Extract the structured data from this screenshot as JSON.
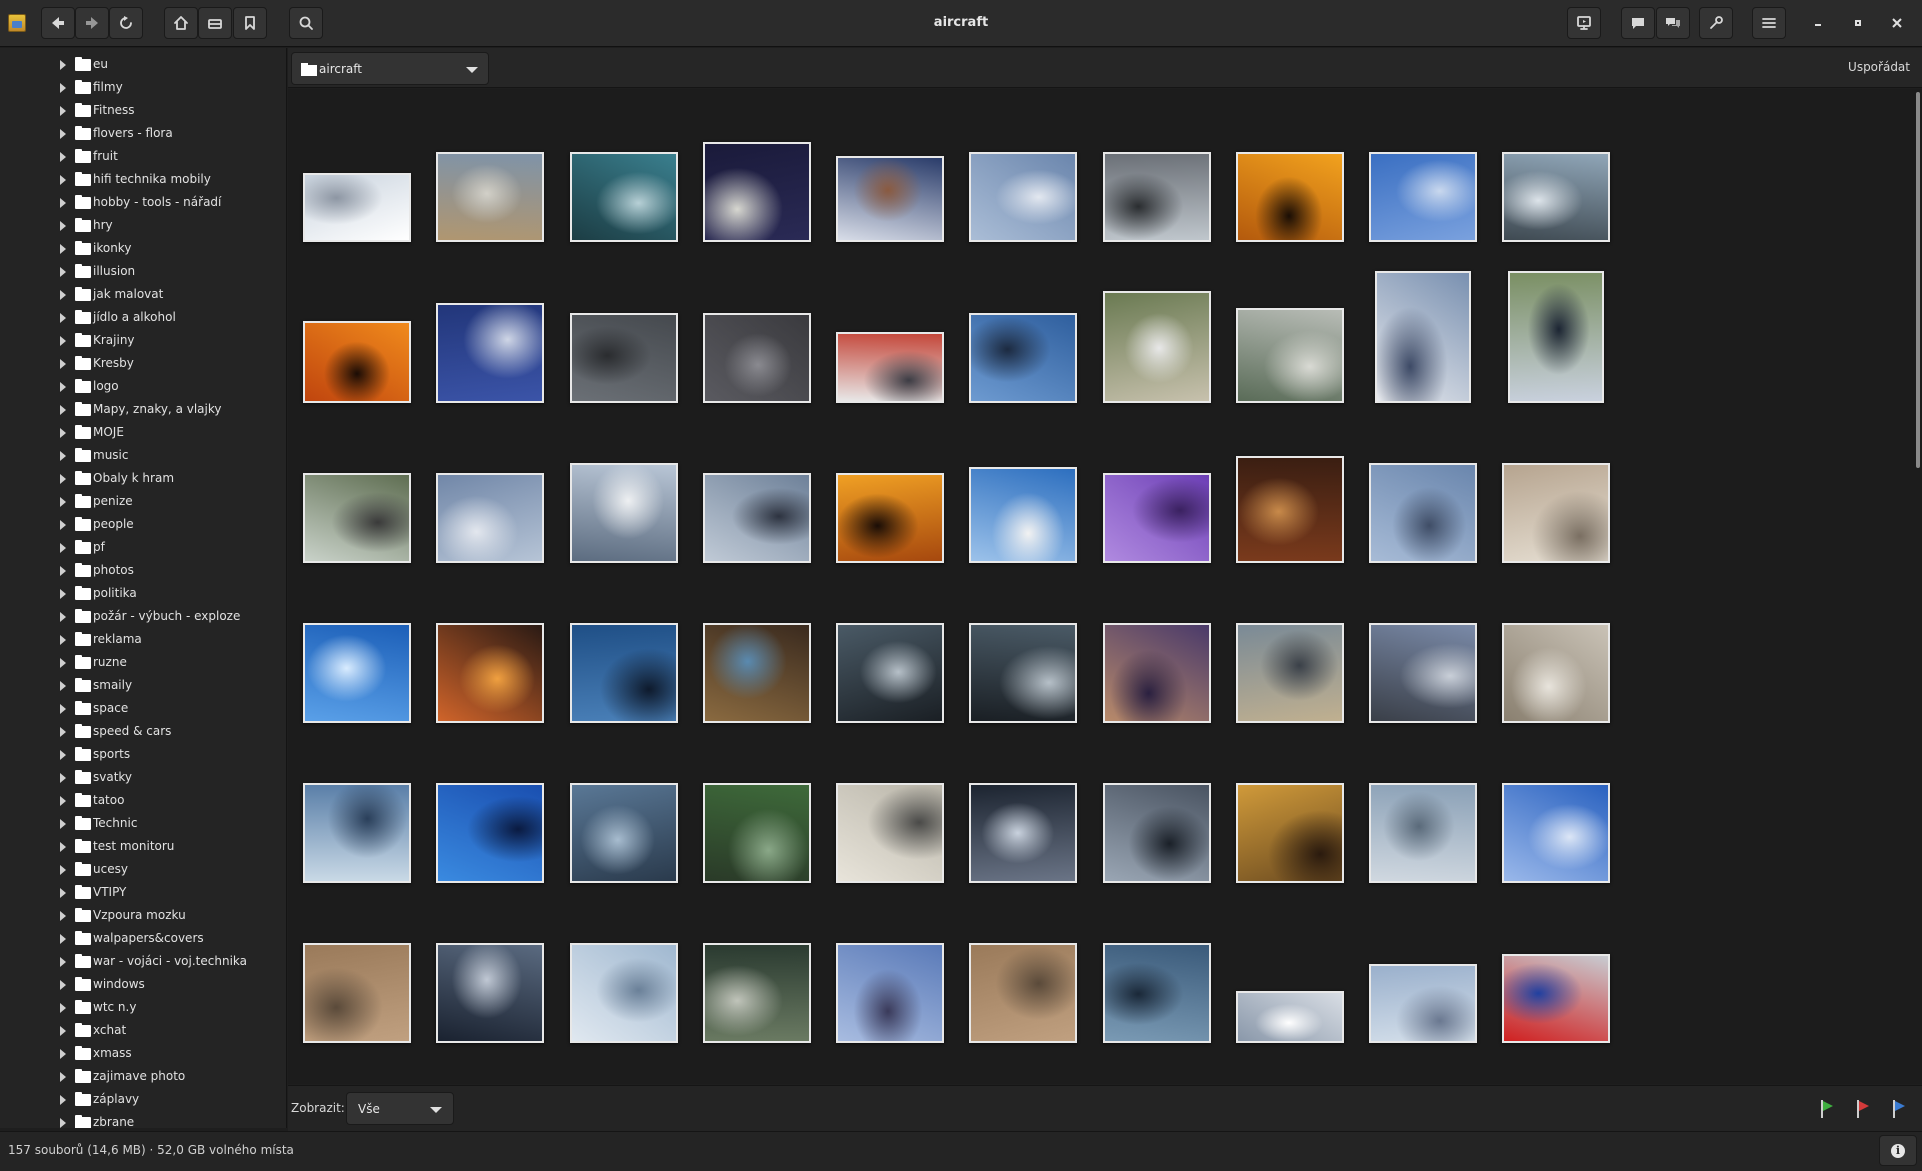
{
  "window": {
    "title": "aircraft"
  },
  "toolbar": {
    "path": "aircraft",
    "sort_label": "Uspořádat"
  },
  "sidebar": {
    "folders": [
      "eu",
      "filmy",
      "Fitness",
      "flovers - flora",
      "fruit",
      "hifi technika mobily",
      "hobby - tools - nářadí",
      "hry",
      "ikonky",
      "illusion",
      "jak malovat",
      "jídlo a alkohol",
      "Krajiny",
      "Kresby",
      "logo",
      "Mapy, znaky, a vlajky",
      "MOJE",
      "music",
      "Obaly k hram",
      "penize",
      "people",
      "pf",
      "photos",
      "politika",
      "požár - výbuch - exploze",
      "reklama",
      "ruzne",
      "smaily",
      "space",
      "speed & cars",
      "sports",
      "svatky",
      "tatoo",
      "Technic",
      "test monitoru",
      "ucesy",
      "VTIPY",
      "Vzpoura mozku",
      "walpapers&covers",
      "war - vojáci - voj.technika",
      "windows",
      "wtc n.y",
      "xchat",
      "xmass",
      "zajimave photo",
      "záplavy",
      "zbrane"
    ]
  },
  "filter": {
    "label": "Zobrazit:",
    "value": "Vše"
  },
  "flags": [
    {
      "color": "#3fae3f"
    },
    {
      "color": "#d23a3a"
    },
    {
      "color": "#3a7bd2"
    }
  ],
  "status": {
    "text": "157 souborů (14,6 MB)  ·  52,0 GB volného místa"
  },
  "icons": [
    "back-icon",
    "forward-icon",
    "reload-icon",
    "home-icon",
    "drive-icon",
    "bookmark-icon",
    "search-icon",
    "slideshow-icon",
    "comment-icon",
    "chat-icon",
    "tools-icon",
    "menu-icon",
    "minimize-icon",
    "maximize-icon",
    "close-icon",
    "info-icon"
  ],
  "thumbnail_palettes": [
    [
      "#c9d3de",
      "#ffffff",
      "#8d96a3"
    ],
    [
      "#7f93a8",
      "#b09670",
      "#d2d0c8"
    ],
    [
      "#3a7f8e",
      "#1c3d44",
      "#b7d0d6"
    ],
    [
      "#1a1a3a",
      "#2a2a55",
      "#d7d7d0"
    ],
    [
      "#2a3c6a",
      "#d8dde8",
      "#8a5a40"
    ],
    [
      "#6b86ad",
      "#aabdd6",
      "#e3e8f0"
    ],
    [
      "#6b7077",
      "#bfc6cc",
      "#2a2d30"
    ],
    [
      "#f2a21e",
      "#b45a0d",
      "#1a0e05"
    ],
    [
      "#3a6fc2",
      "#7aa1de",
      "#c9d8ee"
    ],
    [
      "#90a6b8",
      "#3f4a52",
      "#dde4ea"
    ],
    [
      "#f08a1c",
      "#c0450e",
      "#1a0c05"
    ],
    [
      "#22367a",
      "#3b54a8",
      "#cfd6e6"
    ],
    [
      "#45494e",
      "#6b7076",
      "#2a2c2f"
    ],
    [
      "#3a3a3e",
      "#5a5a60",
      "#8a8a90"
    ],
    [
      "#c4473a",
      "#e8e8e8",
      "#3c3c44"
    ],
    [
      "#2f5f9e",
      "#6d9ad0",
      "#1c2a40"
    ],
    [
      "#6a7a52",
      "#c7c1ad",
      "#e8e8e8"
    ],
    [
      "#b8bcb6",
      "#5a6c58",
      "#d9dad4"
    ],
    [
      "#7990b0",
      "#e8eaee",
      "#3d4a66"
    ],
    [
      "#7a8f63",
      "#c9d1de",
      "#1c2533"
    ],
    [
      "#5f6e52",
      "#c9d2c9",
      "#3a3a3a"
    ],
    [
      "#7187a8",
      "#b6c4d6",
      "#e3e7ee"
    ],
    [
      "#b9c6d6",
      "#5c6c80",
      "#eef0f2"
    ],
    [
      "#6e8199",
      "#c0cad6",
      "#2d3340"
    ],
    [
      "#f0a024",
      "#a6480e",
      "#1a0d06"
    ],
    [
      "#2d6fbf",
      "#9cc2ea",
      "#f2f2f2"
    ],
    [
      "#6c3fb5",
      "#b08ae0",
      "#3a2160"
    ],
    [
      "#3a1e12",
      "#7a3a1c",
      "#c88a4a"
    ],
    [
      "#6a86ad",
      "#a7bbd6",
      "#3f4d66"
    ],
    [
      "#b6a48f",
      "#e7e0d4",
      "#7a6f62"
    ],
    [
      "#1c5fb8",
      "#5aa0e8",
      "#d9ecff"
    ],
    [
      "#2a1a14",
      "#d0642a",
      "#f0a040"
    ],
    [
      "#1f4f86",
      "#4a80b8",
      "#0e1a2c"
    ],
    [
      "#3a2a1e",
      "#8a6a40",
      "#5a8ab0"
    ],
    [
      "#4a5a66",
      "#1a1f24",
      "#b6c0c8"
    ],
    [
      "#4a5a66",
      "#1a1f24",
      "#b6c0c8"
    ],
    [
      "#4a3a6a",
      "#b88a6a",
      "#2a2040"
    ],
    [
      "#7a8a96",
      "#c0b090",
      "#3a4048"
    ],
    [
      "#7a8aa8",
      "#3a3f48",
      "#c9cfd8"
    ],
    [
      "#c9c2b6",
      "#8a8070",
      "#e8e4dc"
    ],
    [
      "#5a7fa8",
      "#c9d9e6",
      "#2a3f5a"
    ],
    [
      "#1a4fb0",
      "#3a8ae0",
      "#0a1a40"
    ],
    [
      "#5a7896",
      "#2a3a4c",
      "#a7bccf"
    ],
    [
      "#3e6a3a",
      "#2a3a28",
      "#8aa888"
    ],
    [
      "#b8b4a8",
      "#e8e4da",
      "#4a4a48"
    ],
    [
      "#1c2430",
      "#6a7486",
      "#c9d2de"
    ],
    [
      "#4a5462",
      "#9aa6b4",
      "#1a2028"
    ],
    [
      "#d09a3a",
      "#6a4a20",
      "#2a1a0e"
    ],
    [
      "#8aa0b6",
      "#d0d8e0",
      "#5a6a7a"
    ],
    [
      "#2a62c0",
      "#9ab8ea",
      "#dce6f6"
    ],
    [
      "#9a7a5a",
      "#c0a080",
      "#5a4a3a"
    ],
    [
      "#5a6a80",
      "#1a2230",
      "#c0c8d4"
    ],
    [
      "#a0b8d0",
      "#e0e8f0",
      "#6a8098"
    ],
    [
      "#2a3a30",
      "#6a7a62",
      "#c0c4ba"
    ],
    [
      "#5a7ab8",
      "#a8bce0",
      "#3a3a5a"
    ],
    [
      "#9a7a5a",
      "#c0a080",
      "#5a4a3a"
    ],
    [
      "#3a5a7a",
      "#7a9ab4",
      "#1a2838"
    ],
    [
      "#d8dde4",
      "#8a98aa",
      "#ffffff"
    ],
    [
      "#9ab0cc",
      "#d4dfea",
      "#6a7890"
    ],
    [
      "#c8ccd2",
      "#d02020",
      "#2040a0"
    ]
  ]
}
